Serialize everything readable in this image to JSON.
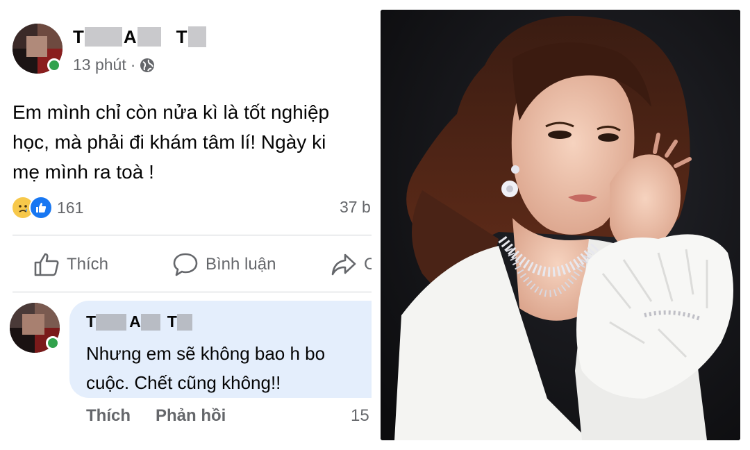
{
  "post": {
    "author_parts": [
      "T",
      "A",
      "T"
    ],
    "time": "13 phút",
    "separator": "·",
    "privacy_icon": "globe-icon",
    "text_lines": [
      "Em mình chỉ còn nửa kì là tốt nghiệp",
      "học, mà phải đi khám tâm lí! Ngày ki",
      "mẹ mình ra toà !"
    ],
    "reaction_count": "161",
    "comment_count": "37 b",
    "reaction_icons": [
      "sad-reaction-icon",
      "like-reaction-icon"
    ]
  },
  "actions": {
    "like": "Thích",
    "comment": "Bình luận",
    "share_partial": "C"
  },
  "comment": {
    "author_parts": [
      "T",
      "A",
      "T"
    ],
    "text_lines": [
      "Nhưng em sẽ không bao h bo",
      "cuộc. Chết cũng không!!"
    ],
    "like": "Thích",
    "reply": "Phản hồi",
    "time": "15"
  },
  "colors": {
    "online": "#31a24c",
    "comment_bubble": "#e4eefc",
    "like_blue": "#1877f2",
    "muted_text": "#65676b"
  }
}
